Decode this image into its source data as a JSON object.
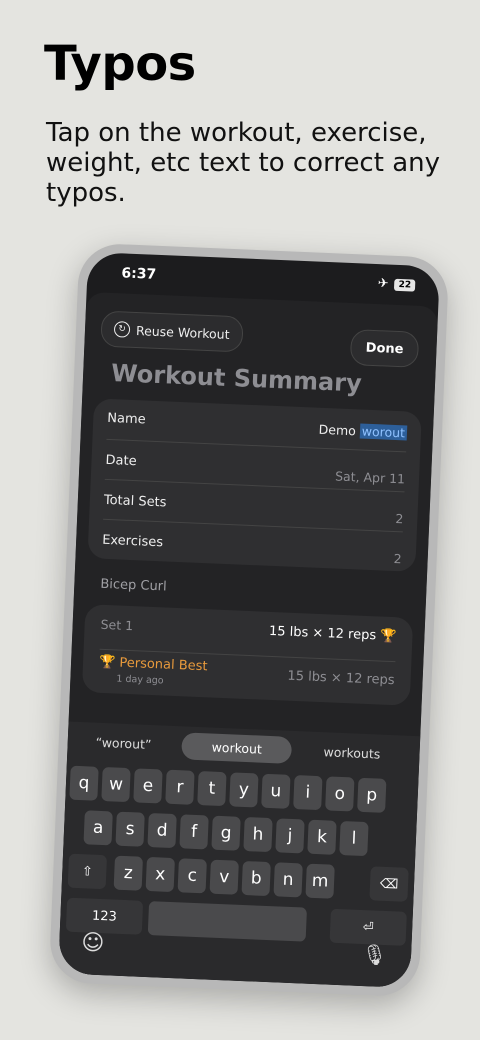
{
  "headline": "Typos",
  "subtitle": "Tap on the workout, exercise, weight, etc text to correct any typos.",
  "status": {
    "time": "6:37",
    "battery": "22"
  },
  "header": {
    "reuse_label": "Reuse Workout",
    "done_label": "Done",
    "title": "Workout Summary"
  },
  "summary": {
    "name_label": "Name",
    "name_value_prefix": "Demo",
    "name_value_selected": "worout",
    "date_label": "Date",
    "date_value": "Sat, Apr 11",
    "total_sets_label": "Total Sets",
    "total_sets_value": "2",
    "exercises_label": "Exercises",
    "exercises_value": "2"
  },
  "exercise": {
    "name": "Bicep Curl",
    "set_label": "Set 1",
    "set_value": "15 lbs × 12 reps",
    "pb_label": "Personal Best",
    "pb_sub": "1 day ago",
    "pb_value": "15 lbs × 12 reps"
  },
  "keyboard": {
    "suggestions": [
      "“worout”",
      "workout",
      "workouts"
    ],
    "row1": [
      "q",
      "w",
      "e",
      "r",
      "t",
      "y",
      "u",
      "i",
      "o",
      "p"
    ],
    "row2": [
      "a",
      "s",
      "d",
      "f",
      "g",
      "h",
      "j",
      "k",
      "l"
    ],
    "row3": [
      "z",
      "x",
      "c",
      "v",
      "b",
      "n",
      "m"
    ],
    "numbers_label": "123"
  },
  "icons": {
    "trophy": "trophy-icon",
    "shift": "shift-icon",
    "backspace": "backspace-icon",
    "return": "return-icon",
    "emoji": "emoji-icon",
    "mic": "mic-icon",
    "airplane": "airplane-icon"
  }
}
